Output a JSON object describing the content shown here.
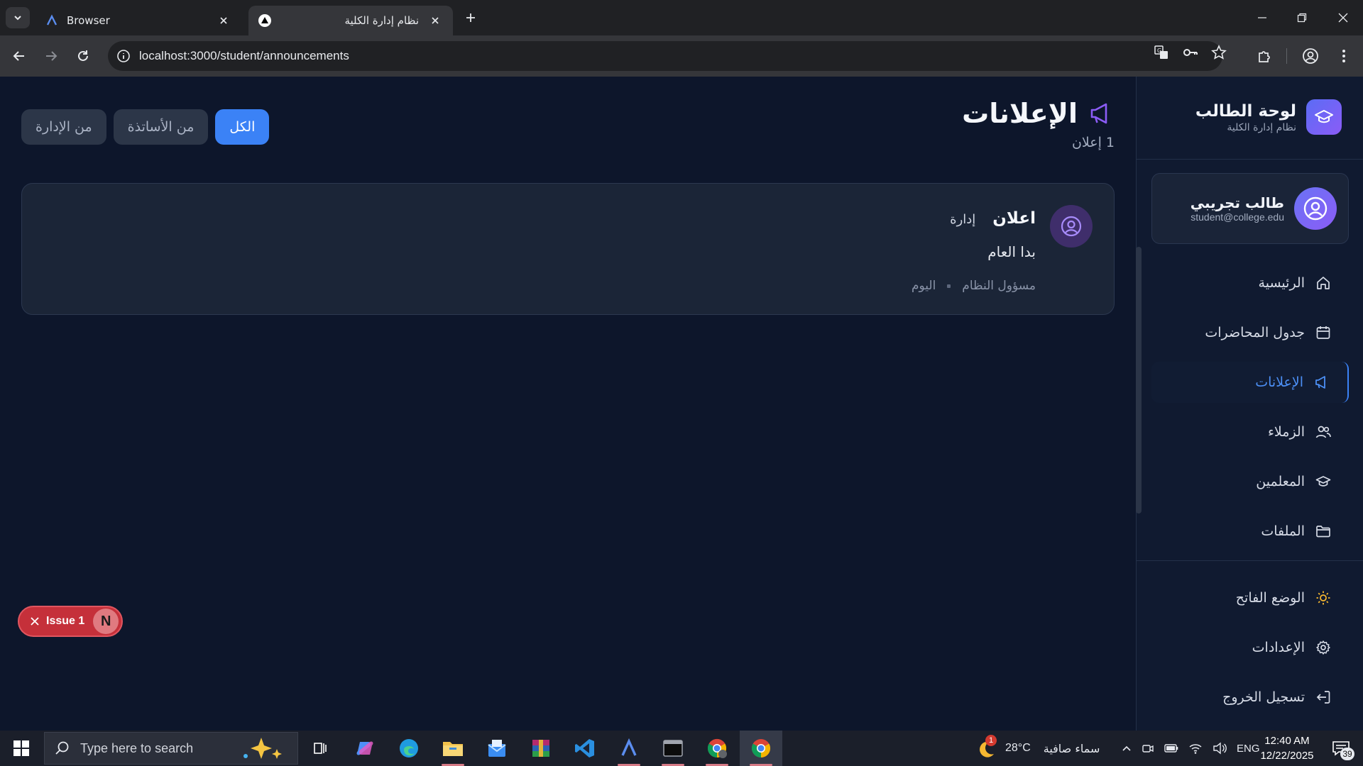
{
  "browser": {
    "tabs": [
      {
        "title": "Browser",
        "active": false
      },
      {
        "title": "نظام إدارة الكلية",
        "active": true
      }
    ],
    "url": "localhost:3000/student/announcements"
  },
  "sidebar": {
    "brand_title": "لوحة الطالب",
    "brand_subtitle": "نظام إدارة الكلية",
    "user_name": "طالب تجريبي",
    "user_email": "student@college.edu",
    "nav": [
      {
        "label": "الرئيسية",
        "icon": "home-icon"
      },
      {
        "label": "جدول المحاضرات",
        "icon": "calendar-icon"
      },
      {
        "label": "الإعلانات",
        "icon": "megaphone-icon",
        "active": true
      },
      {
        "label": "الزملاء",
        "icon": "users-icon"
      },
      {
        "label": "المعلمين",
        "icon": "graduation-cap-icon"
      },
      {
        "label": "الملفات",
        "icon": "folder-icon"
      }
    ],
    "bottom": [
      {
        "label": "الوضع الفاتح",
        "icon": "sun-icon"
      },
      {
        "label": "الإعدادات",
        "icon": "gear-icon"
      },
      {
        "label": "تسجيل الخروج",
        "icon": "logout-icon"
      }
    ]
  },
  "page": {
    "title": "الإعلانات",
    "count": "1 إعلان",
    "filters": [
      {
        "label": "الكل",
        "active": true
      },
      {
        "label": "من الأساتذة",
        "active": false
      },
      {
        "label": "من الإدارة",
        "active": false
      }
    ]
  },
  "announcements": [
    {
      "title": "اعلان",
      "tag": "إدارة",
      "body": "بدا العام",
      "author": "مسؤول النظام",
      "date": "اليوم"
    }
  ],
  "dev_overlay": {
    "issue_label": "Issue 1",
    "badge": "N"
  },
  "taskbar": {
    "search_placeholder": "Type here to search",
    "weather_temp": "28°C",
    "weather_text": "سماء صافية",
    "weather_badge": "1",
    "language": "ENG",
    "time": "12:40 AM",
    "date": "12/22/2025",
    "notifications": "39"
  },
  "colors": {
    "accent": "#3b82f6",
    "brand_gradient_start": "#5b6cf5",
    "brand_gradient_end": "#8b5cf6",
    "issue_red": "#c5303a"
  }
}
